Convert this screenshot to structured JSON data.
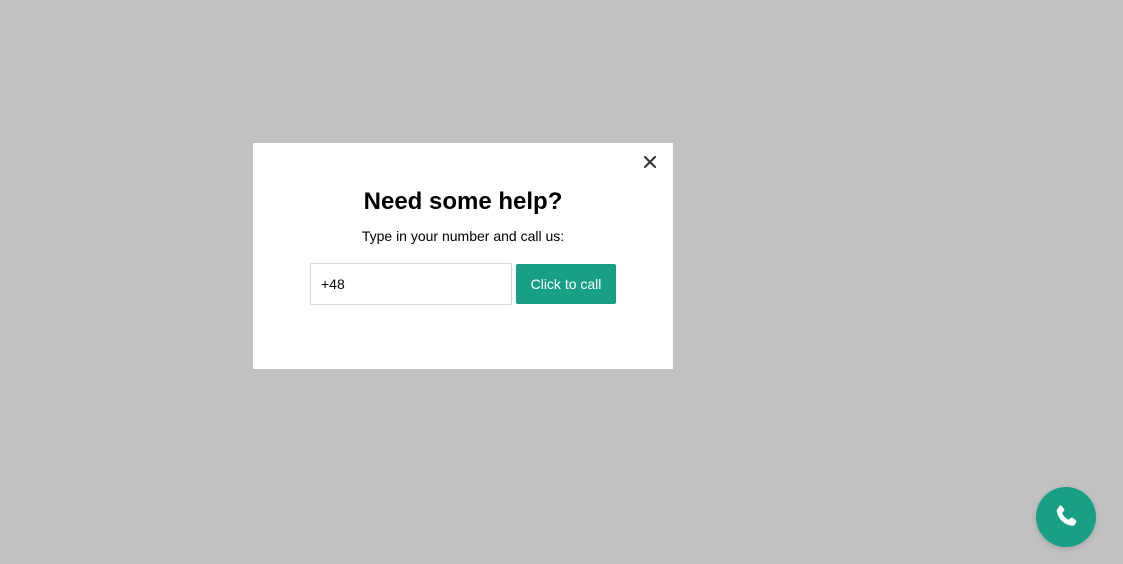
{
  "modal": {
    "title": "Need some help?",
    "subtitle": "Type in your number and call us:",
    "phone_input_value": "+48",
    "call_button_label": "Click to call",
    "close_icon": "close-icon"
  },
  "floating_button": {
    "icon": "phone-icon"
  },
  "colors": {
    "accent": "#17a085",
    "overlay": "#c1c1c1",
    "modal_background": "#ffffff"
  }
}
